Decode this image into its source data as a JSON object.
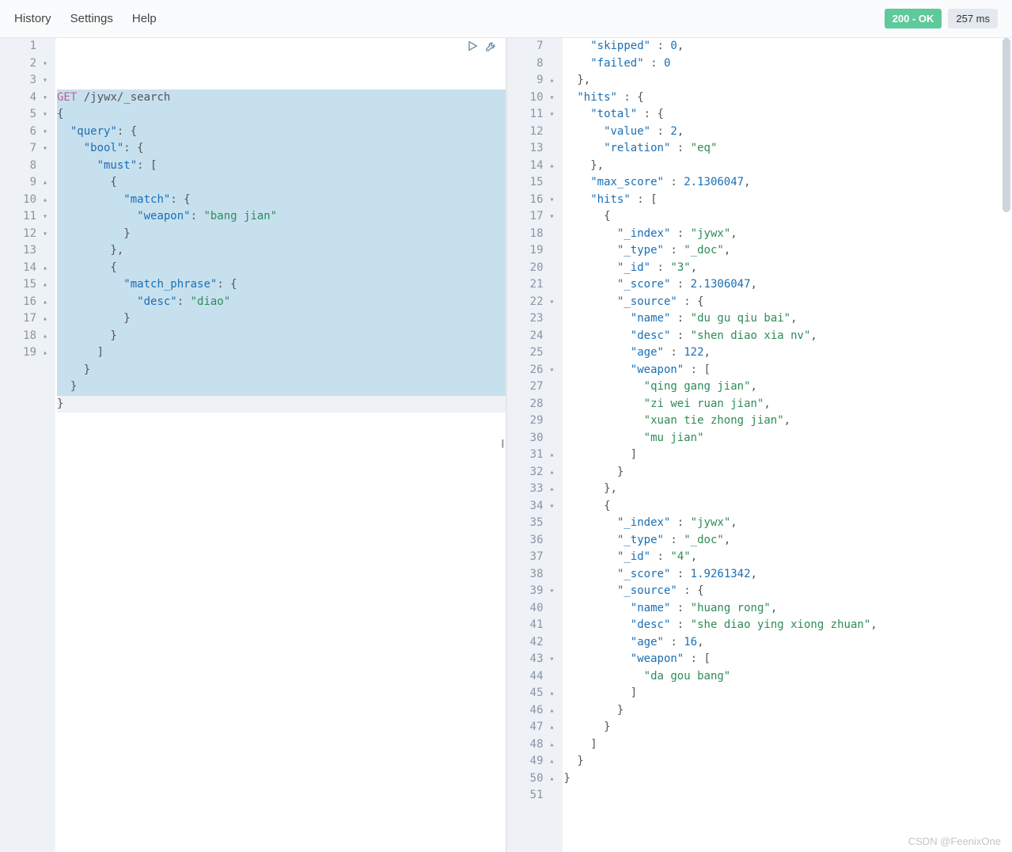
{
  "menu": {
    "history": "History",
    "settings": "Settings",
    "help": "Help"
  },
  "status": {
    "code": "200 - OK",
    "time": "257 ms"
  },
  "watermark": "CSDN @FeenixOne",
  "left": {
    "lines": [
      {
        "n": "1",
        "f": "",
        "hl": true,
        "seg": [
          {
            "t": "GET",
            "c": "method"
          },
          {
            "t": " /jywx/_search",
            "c": "default"
          }
        ]
      },
      {
        "n": "2",
        "f": "▾",
        "hl": true,
        "seg": [
          {
            "t": "{",
            "c": "punc"
          }
        ]
      },
      {
        "n": "3",
        "f": "▾",
        "hl": true,
        "seg": [
          {
            "t": "  ",
            "c": "default"
          },
          {
            "t": "\"query\"",
            "c": "key"
          },
          {
            "t": ": {",
            "c": "punc"
          }
        ]
      },
      {
        "n": "4",
        "f": "▾",
        "hl": true,
        "seg": [
          {
            "t": "    ",
            "c": "default"
          },
          {
            "t": "\"bool\"",
            "c": "key"
          },
          {
            "t": ": {",
            "c": "punc"
          }
        ]
      },
      {
        "n": "5",
        "f": "▾",
        "hl": true,
        "seg": [
          {
            "t": "      ",
            "c": "default"
          },
          {
            "t": "\"must\"",
            "c": "key"
          },
          {
            "t": ": [",
            "c": "punc"
          }
        ]
      },
      {
        "n": "6",
        "f": "▾",
        "hl": true,
        "seg": [
          {
            "t": "        {",
            "c": "punc"
          }
        ]
      },
      {
        "n": "7",
        "f": "▾",
        "hl": true,
        "seg": [
          {
            "t": "          ",
            "c": "default"
          },
          {
            "t": "\"match\"",
            "c": "key"
          },
          {
            "t": ": {",
            "c": "punc"
          }
        ]
      },
      {
        "n": "8",
        "f": "",
        "hl": true,
        "seg": [
          {
            "t": "            ",
            "c": "default"
          },
          {
            "t": "\"weapon\"",
            "c": "key"
          },
          {
            "t": ": ",
            "c": "punc"
          },
          {
            "t": "\"bang jian\"",
            "c": "str"
          }
        ]
      },
      {
        "n": "9",
        "f": "▴",
        "hl": true,
        "seg": [
          {
            "t": "          }",
            "c": "punc"
          }
        ]
      },
      {
        "n": "10",
        "f": "▴",
        "hl": true,
        "seg": [
          {
            "t": "        },",
            "c": "punc"
          }
        ]
      },
      {
        "n": "11",
        "f": "▾",
        "hl": true,
        "seg": [
          {
            "t": "        {",
            "c": "punc"
          }
        ]
      },
      {
        "n": "12",
        "f": "▾",
        "hl": true,
        "seg": [
          {
            "t": "          ",
            "c": "default"
          },
          {
            "t": "\"match_phrase\"",
            "c": "key"
          },
          {
            "t": ": {",
            "c": "punc"
          }
        ]
      },
      {
        "n": "13",
        "f": "",
        "hl": true,
        "seg": [
          {
            "t": "            ",
            "c": "default"
          },
          {
            "t": "\"desc\"",
            "c": "key"
          },
          {
            "t": ": ",
            "c": "punc"
          },
          {
            "t": "\"diao\"",
            "c": "str"
          }
        ]
      },
      {
        "n": "14",
        "f": "▴",
        "hl": true,
        "seg": [
          {
            "t": "          }",
            "c": "punc"
          }
        ]
      },
      {
        "n": "15",
        "f": "▴",
        "hl": true,
        "seg": [
          {
            "t": "        }",
            "c": "punc"
          }
        ]
      },
      {
        "n": "16",
        "f": "▴",
        "hl": true,
        "seg": [
          {
            "t": "      ]",
            "c": "punc"
          }
        ]
      },
      {
        "n": "17",
        "f": "▴",
        "hl": true,
        "seg": [
          {
            "t": "    }",
            "c": "punc"
          }
        ]
      },
      {
        "n": "18",
        "f": "▴",
        "hl": true,
        "seg": [
          {
            "t": "  }",
            "c": "punc"
          }
        ]
      },
      {
        "n": "19",
        "f": "▴",
        "cursor": true,
        "seg": [
          {
            "t": "}",
            "c": "punc"
          }
        ]
      }
    ]
  },
  "right": {
    "lines": [
      {
        "n": "7",
        "f": "",
        "seg": [
          {
            "t": "    ",
            "c": "default"
          },
          {
            "t": "\"skipped\"",
            "c": "key"
          },
          {
            "t": " : ",
            "c": "punc"
          },
          {
            "t": "0",
            "c": "num"
          },
          {
            "t": ",",
            "c": "punc"
          }
        ]
      },
      {
        "n": "8",
        "f": "",
        "seg": [
          {
            "t": "    ",
            "c": "default"
          },
          {
            "t": "\"failed\"",
            "c": "key"
          },
          {
            "t": " : ",
            "c": "punc"
          },
          {
            "t": "0",
            "c": "num"
          }
        ]
      },
      {
        "n": "9",
        "f": "▴",
        "seg": [
          {
            "t": "  },",
            "c": "punc"
          }
        ]
      },
      {
        "n": "10",
        "f": "▾",
        "seg": [
          {
            "t": "  ",
            "c": "default"
          },
          {
            "t": "\"hits\"",
            "c": "key"
          },
          {
            "t": " : {",
            "c": "punc"
          }
        ]
      },
      {
        "n": "11",
        "f": "▾",
        "seg": [
          {
            "t": "    ",
            "c": "default"
          },
          {
            "t": "\"total\"",
            "c": "key"
          },
          {
            "t": " : {",
            "c": "punc"
          }
        ]
      },
      {
        "n": "12",
        "f": "",
        "seg": [
          {
            "t": "      ",
            "c": "default"
          },
          {
            "t": "\"value\"",
            "c": "key"
          },
          {
            "t": " : ",
            "c": "punc"
          },
          {
            "t": "2",
            "c": "num"
          },
          {
            "t": ",",
            "c": "punc"
          }
        ]
      },
      {
        "n": "13",
        "f": "",
        "seg": [
          {
            "t": "      ",
            "c": "default"
          },
          {
            "t": "\"relation\"",
            "c": "key"
          },
          {
            "t": " : ",
            "c": "punc"
          },
          {
            "t": "\"eq\"",
            "c": "str"
          }
        ]
      },
      {
        "n": "14",
        "f": "▴",
        "seg": [
          {
            "t": "    },",
            "c": "punc"
          }
        ]
      },
      {
        "n": "15",
        "f": "",
        "seg": [
          {
            "t": "    ",
            "c": "default"
          },
          {
            "t": "\"max_score\"",
            "c": "key"
          },
          {
            "t": " : ",
            "c": "punc"
          },
          {
            "t": "2.1306047",
            "c": "num"
          },
          {
            "t": ",",
            "c": "punc"
          }
        ]
      },
      {
        "n": "16",
        "f": "▾",
        "seg": [
          {
            "t": "    ",
            "c": "default"
          },
          {
            "t": "\"hits\"",
            "c": "key"
          },
          {
            "t": " : [",
            "c": "punc"
          }
        ]
      },
      {
        "n": "17",
        "f": "▾",
        "seg": [
          {
            "t": "      {",
            "c": "punc"
          }
        ]
      },
      {
        "n": "18",
        "f": "",
        "seg": [
          {
            "t": "        ",
            "c": "default"
          },
          {
            "t": "\"_index\"",
            "c": "key"
          },
          {
            "t": " : ",
            "c": "punc"
          },
          {
            "t": "\"jywx\"",
            "c": "str"
          },
          {
            "t": ",",
            "c": "punc"
          }
        ]
      },
      {
        "n": "19",
        "f": "",
        "seg": [
          {
            "t": "        ",
            "c": "default"
          },
          {
            "t": "\"_type\"",
            "c": "key"
          },
          {
            "t": " : ",
            "c": "punc"
          },
          {
            "t": "\"_doc\"",
            "c": "str"
          },
          {
            "t": ",",
            "c": "punc"
          }
        ]
      },
      {
        "n": "20",
        "f": "",
        "seg": [
          {
            "t": "        ",
            "c": "default"
          },
          {
            "t": "\"_id\"",
            "c": "key"
          },
          {
            "t": " : ",
            "c": "punc"
          },
          {
            "t": "\"3\"",
            "c": "str"
          },
          {
            "t": ",",
            "c": "punc"
          }
        ]
      },
      {
        "n": "21",
        "f": "",
        "seg": [
          {
            "t": "        ",
            "c": "default"
          },
          {
            "t": "\"_score\"",
            "c": "key"
          },
          {
            "t": " : ",
            "c": "punc"
          },
          {
            "t": "2.1306047",
            "c": "num"
          },
          {
            "t": ",",
            "c": "punc"
          }
        ]
      },
      {
        "n": "22",
        "f": "▾",
        "seg": [
          {
            "t": "        ",
            "c": "default"
          },
          {
            "t": "\"_source\"",
            "c": "key"
          },
          {
            "t": " : {",
            "c": "punc"
          }
        ]
      },
      {
        "n": "23",
        "f": "",
        "seg": [
          {
            "t": "          ",
            "c": "default"
          },
          {
            "t": "\"name\"",
            "c": "key"
          },
          {
            "t": " : ",
            "c": "punc"
          },
          {
            "t": "\"du gu qiu bai\"",
            "c": "str"
          },
          {
            "t": ",",
            "c": "punc"
          }
        ]
      },
      {
        "n": "24",
        "f": "",
        "seg": [
          {
            "t": "          ",
            "c": "default"
          },
          {
            "t": "\"desc\"",
            "c": "key"
          },
          {
            "t": " : ",
            "c": "punc"
          },
          {
            "t": "\"shen diao xia nv\"",
            "c": "str"
          },
          {
            "t": ",",
            "c": "punc"
          }
        ]
      },
      {
        "n": "25",
        "f": "",
        "seg": [
          {
            "t": "          ",
            "c": "default"
          },
          {
            "t": "\"age\"",
            "c": "key"
          },
          {
            "t": " : ",
            "c": "punc"
          },
          {
            "t": "122",
            "c": "num"
          },
          {
            "t": ",",
            "c": "punc"
          }
        ]
      },
      {
        "n": "26",
        "f": "▾",
        "seg": [
          {
            "t": "          ",
            "c": "default"
          },
          {
            "t": "\"weapon\"",
            "c": "key"
          },
          {
            "t": " : [",
            "c": "punc"
          }
        ]
      },
      {
        "n": "27",
        "f": "",
        "seg": [
          {
            "t": "            ",
            "c": "default"
          },
          {
            "t": "\"qing gang jian\"",
            "c": "str"
          },
          {
            "t": ",",
            "c": "punc"
          }
        ]
      },
      {
        "n": "28",
        "f": "",
        "seg": [
          {
            "t": "            ",
            "c": "default"
          },
          {
            "t": "\"zi wei ruan jian\"",
            "c": "str"
          },
          {
            "t": ",",
            "c": "punc"
          }
        ]
      },
      {
        "n": "29",
        "f": "",
        "seg": [
          {
            "t": "            ",
            "c": "default"
          },
          {
            "t": "\"xuan tie zhong jian\"",
            "c": "str"
          },
          {
            "t": ",",
            "c": "punc"
          }
        ]
      },
      {
        "n": "30",
        "f": "",
        "seg": [
          {
            "t": "            ",
            "c": "default"
          },
          {
            "t": "\"mu jian\"",
            "c": "str"
          }
        ]
      },
      {
        "n": "31",
        "f": "▴",
        "seg": [
          {
            "t": "          ]",
            "c": "punc"
          }
        ]
      },
      {
        "n": "32",
        "f": "▴",
        "seg": [
          {
            "t": "        }",
            "c": "punc"
          }
        ]
      },
      {
        "n": "33",
        "f": "▴",
        "seg": [
          {
            "t": "      },",
            "c": "punc"
          }
        ]
      },
      {
        "n": "34",
        "f": "▾",
        "seg": [
          {
            "t": "      {",
            "c": "punc"
          }
        ]
      },
      {
        "n": "35",
        "f": "",
        "seg": [
          {
            "t": "        ",
            "c": "default"
          },
          {
            "t": "\"_index\"",
            "c": "key"
          },
          {
            "t": " : ",
            "c": "punc"
          },
          {
            "t": "\"jywx\"",
            "c": "str"
          },
          {
            "t": ",",
            "c": "punc"
          }
        ]
      },
      {
        "n": "36",
        "f": "",
        "seg": [
          {
            "t": "        ",
            "c": "default"
          },
          {
            "t": "\"_type\"",
            "c": "key"
          },
          {
            "t": " : ",
            "c": "punc"
          },
          {
            "t": "\"_doc\"",
            "c": "str"
          },
          {
            "t": ",",
            "c": "punc"
          }
        ]
      },
      {
        "n": "37",
        "f": "",
        "seg": [
          {
            "t": "        ",
            "c": "default"
          },
          {
            "t": "\"_id\"",
            "c": "key"
          },
          {
            "t": " : ",
            "c": "punc"
          },
          {
            "t": "\"4\"",
            "c": "str"
          },
          {
            "t": ",",
            "c": "punc"
          }
        ]
      },
      {
        "n": "38",
        "f": "",
        "seg": [
          {
            "t": "        ",
            "c": "default"
          },
          {
            "t": "\"_score\"",
            "c": "key"
          },
          {
            "t": " : ",
            "c": "punc"
          },
          {
            "t": "1.9261342",
            "c": "num"
          },
          {
            "t": ",",
            "c": "punc"
          }
        ]
      },
      {
        "n": "39",
        "f": "▾",
        "seg": [
          {
            "t": "        ",
            "c": "default"
          },
          {
            "t": "\"_source\"",
            "c": "key"
          },
          {
            "t": " : {",
            "c": "punc"
          }
        ]
      },
      {
        "n": "40",
        "f": "",
        "seg": [
          {
            "t": "          ",
            "c": "default"
          },
          {
            "t": "\"name\"",
            "c": "key"
          },
          {
            "t": " : ",
            "c": "punc"
          },
          {
            "t": "\"huang rong\"",
            "c": "str"
          },
          {
            "t": ",",
            "c": "punc"
          }
        ]
      },
      {
        "n": "41",
        "f": "",
        "seg": [
          {
            "t": "          ",
            "c": "default"
          },
          {
            "t": "\"desc\"",
            "c": "key"
          },
          {
            "t": " : ",
            "c": "punc"
          },
          {
            "t": "\"she diao ying xiong zhuan\"",
            "c": "str"
          },
          {
            "t": ",",
            "c": "punc"
          }
        ]
      },
      {
        "n": "42",
        "f": "",
        "seg": [
          {
            "t": "          ",
            "c": "default"
          },
          {
            "t": "\"age\"",
            "c": "key"
          },
          {
            "t": " : ",
            "c": "punc"
          },
          {
            "t": "16",
            "c": "num"
          },
          {
            "t": ",",
            "c": "punc"
          }
        ]
      },
      {
        "n": "43",
        "f": "▾",
        "seg": [
          {
            "t": "          ",
            "c": "default"
          },
          {
            "t": "\"weapon\"",
            "c": "key"
          },
          {
            "t": " : [",
            "c": "punc"
          }
        ]
      },
      {
        "n": "44",
        "f": "",
        "seg": [
          {
            "t": "            ",
            "c": "default"
          },
          {
            "t": "\"da gou bang\"",
            "c": "str"
          }
        ]
      },
      {
        "n": "45",
        "f": "▴",
        "seg": [
          {
            "t": "          ]",
            "c": "punc"
          }
        ]
      },
      {
        "n": "46",
        "f": "▴",
        "seg": [
          {
            "t": "        }",
            "c": "punc"
          }
        ]
      },
      {
        "n": "47",
        "f": "▴",
        "seg": [
          {
            "t": "      }",
            "c": "punc"
          }
        ]
      },
      {
        "n": "48",
        "f": "▴",
        "seg": [
          {
            "t": "    ]",
            "c": "punc"
          }
        ]
      },
      {
        "n": "49",
        "f": "▴",
        "seg": [
          {
            "t": "  }",
            "c": "punc"
          }
        ]
      },
      {
        "n": "50",
        "f": "▴",
        "seg": [
          {
            "t": "}",
            "c": "punc"
          }
        ]
      },
      {
        "n": "51",
        "f": "",
        "seg": []
      }
    ]
  }
}
